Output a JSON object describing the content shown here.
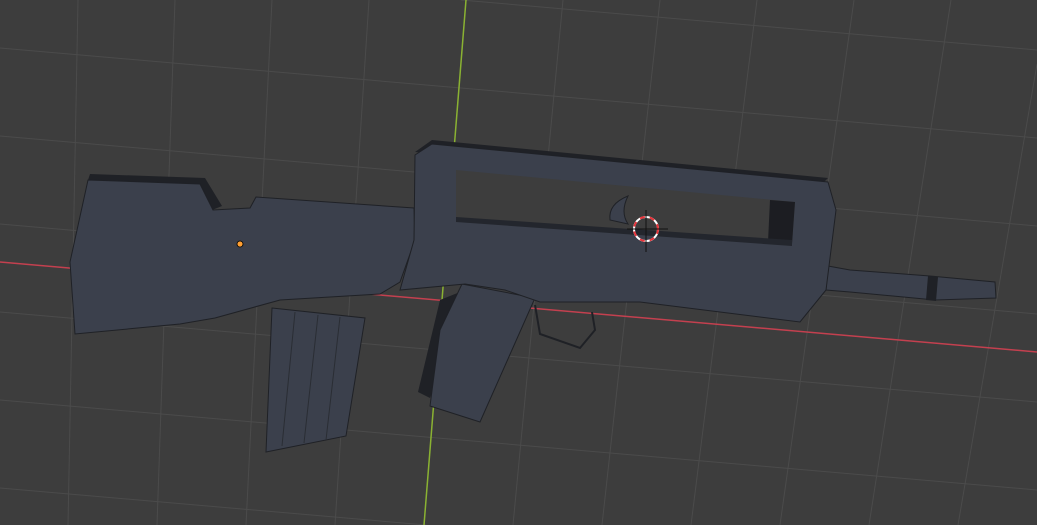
{
  "viewport": {
    "background_color": "#3d3d3d",
    "grid_color": "#4b4b4b",
    "x_axis_color": "#c4404f",
    "y_axis_color": "#8ab232",
    "model_color": "#3b404c",
    "model_shadow_color": "#1f2126",
    "origin_color": "#ffa033",
    "cursor_colors": [
      "#e8333a",
      "#ffffff"
    ]
  }
}
